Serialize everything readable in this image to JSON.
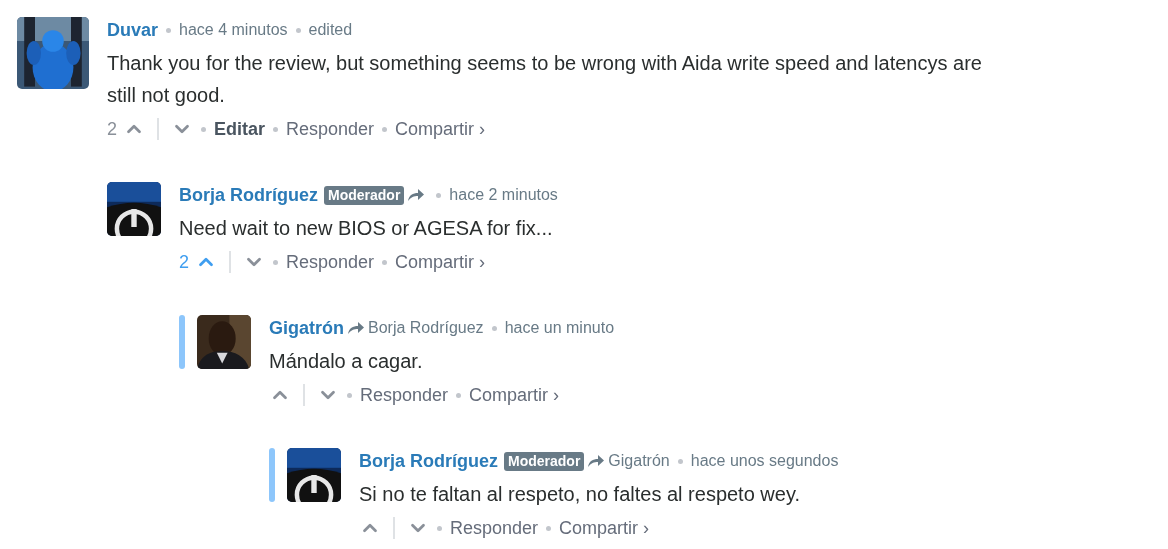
{
  "comments": [
    {
      "author": "Duvar",
      "reply_marker": false,
      "time": "hace 4 minutos",
      "edited_label": "edited",
      "highlighted": false,
      "text": "Thank you for the review, but something seems to be wrong with Aida write speed and latencys are still not good.",
      "votes": "2",
      "upvoted": false,
      "actions": [
        {
          "emphasized": true,
          "label": "Editar"
        },
        {
          "emphasized": false,
          "label": "Responder"
        },
        {
          "emphasized": false,
          "label": "Compartir ›"
        }
      ],
      "children": [
        {
          "author": "Borja Rodríguez",
          "badge": "Moderador",
          "reply_marker": true,
          "time": "hace 2 minutos",
          "highlighted": false,
          "text": "Need wait to new BIOS or AGESA for fix...",
          "votes": "2",
          "upvoted": true,
          "actions": [
            {
              "emphasized": false,
              "label": "Responder"
            },
            {
              "emphasized": false,
              "label": "Compartir ›"
            }
          ],
          "children": [
            {
              "author": "Gigatrón",
              "reply_marker": true,
              "reply_to": "Borja Rodríguez",
              "time": "hace un minuto",
              "highlighted": true,
              "text": "Mándalo a cagar.",
              "upvoted": false,
              "actions": [
                {
                  "emphasized": false,
                  "label": "Responder"
                },
                {
                  "emphasized": false,
                  "label": "Compartir ›"
                }
              ],
              "children": [
                {
                  "author": "Borja Rodríguez",
                  "badge": "Moderador",
                  "reply_marker": true,
                  "reply_to": "Gigatrón",
                  "time": "hace unos segundos",
                  "highlighted": true,
                  "text": "Si no te faltan al respeto, no faltes al respeto wey.",
                  "upvoted": false,
                  "actions": [
                    {
                      "emphasized": false,
                      "label": "Responder"
                    },
                    {
                      "emphasized": false,
                      "label": "Compartir ›"
                    }
                  ]
                }
              ]
            }
          ]
        }
      ]
    }
  ]
}
